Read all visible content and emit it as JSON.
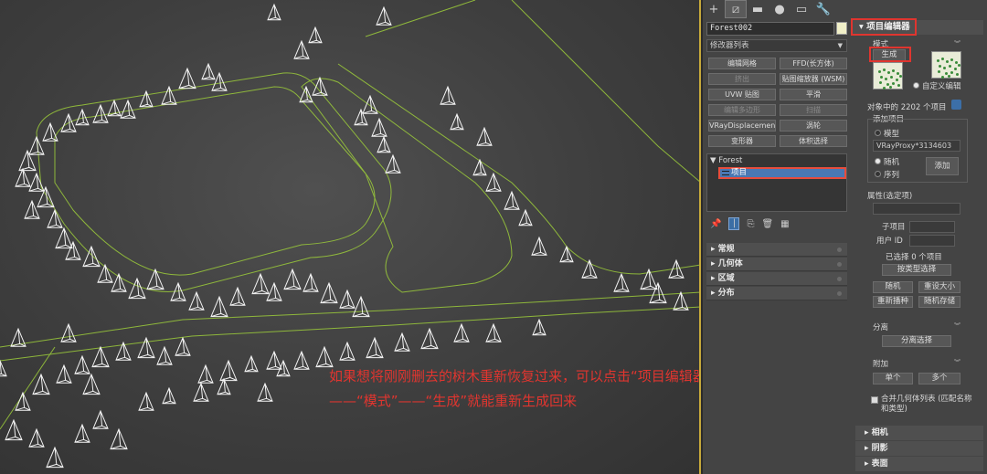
{
  "toolbar": {
    "tabs": [
      "create-tab",
      "modify-tab",
      "hierarchy-tab",
      "motion-tab",
      "display-tab",
      "utilities-tab"
    ],
    "tab_glyphs": [
      "+",
      "⧄",
      "▬",
      "●",
      "▭",
      "🔧"
    ]
  },
  "object": {
    "name": "Forest002",
    "color": "#f1f0c8"
  },
  "modifier_list": {
    "label": "修改器列表"
  },
  "modifier_buttons": [
    {
      "label": "编辑网格",
      "disabled": false
    },
    {
      "label": "FFD(长方体)",
      "disabled": false
    },
    {
      "label": "挤出",
      "disabled": true
    },
    {
      "label": "贴图缩放器 (WSM)",
      "disabled": false
    },
    {
      "label": "UVW 贴图",
      "disabled": false
    },
    {
      "label": "平滑",
      "disabled": false
    },
    {
      "label": "编辑多边形",
      "disabled": true
    },
    {
      "label": "扫描",
      "disabled": true
    },
    {
      "label": "VRayDisplacementM",
      "disabled": false
    },
    {
      "label": "涡轮",
      "disabled": false
    },
    {
      "label": "变形器",
      "disabled": false
    },
    {
      "label": "体积选择",
      "disabled": false
    }
  ],
  "stack": {
    "root": "Forest",
    "selected": "项目"
  },
  "rollups_left": [
    "常规",
    "几何体",
    "区域",
    "分布"
  ],
  "right": {
    "title": "项目编辑器",
    "mode_label": "模式",
    "generate_label": "生成",
    "custom_edit_label": "自定义编辑",
    "count_text": "对象中的 2202 个项目",
    "add_items_label": "添加项目",
    "model_label": "模型",
    "model_value": "VRayProxy*3134603",
    "random_label": "随机",
    "sequence_label": "序列",
    "add_button": "添加",
    "props_label": "属性(选定项)",
    "subitem_label": "子项目",
    "userid_label": "用户 ID",
    "selected_text": "已选择 0 个项目",
    "select_by_type": "按类型选择",
    "random_btn": "随机",
    "reset_size": "重设大小",
    "reseed": "重新播种",
    "random_store": "随机存储",
    "detach_label": "分离",
    "detach_select": "分离选择",
    "attach_label": "附加",
    "single": "单个",
    "multiple": "多个",
    "merge_text": "合并几何体列表 (匹配名称和类型)"
  },
  "bottom_rollups": [
    "相机",
    "阴影",
    "表面"
  ],
  "caption": {
    "line1": "如果想将刚刚删去的树木重新恢复过来，可以点击“项目编辑器”",
    "line2": "——“模式”——“生成”就能重新生成回来"
  },
  "colors": {
    "accent_red": "#e0352f",
    "viewport_border": "#c7a93a",
    "tree_stroke": "#f2f2f2",
    "spline": "#9ccc3a"
  }
}
